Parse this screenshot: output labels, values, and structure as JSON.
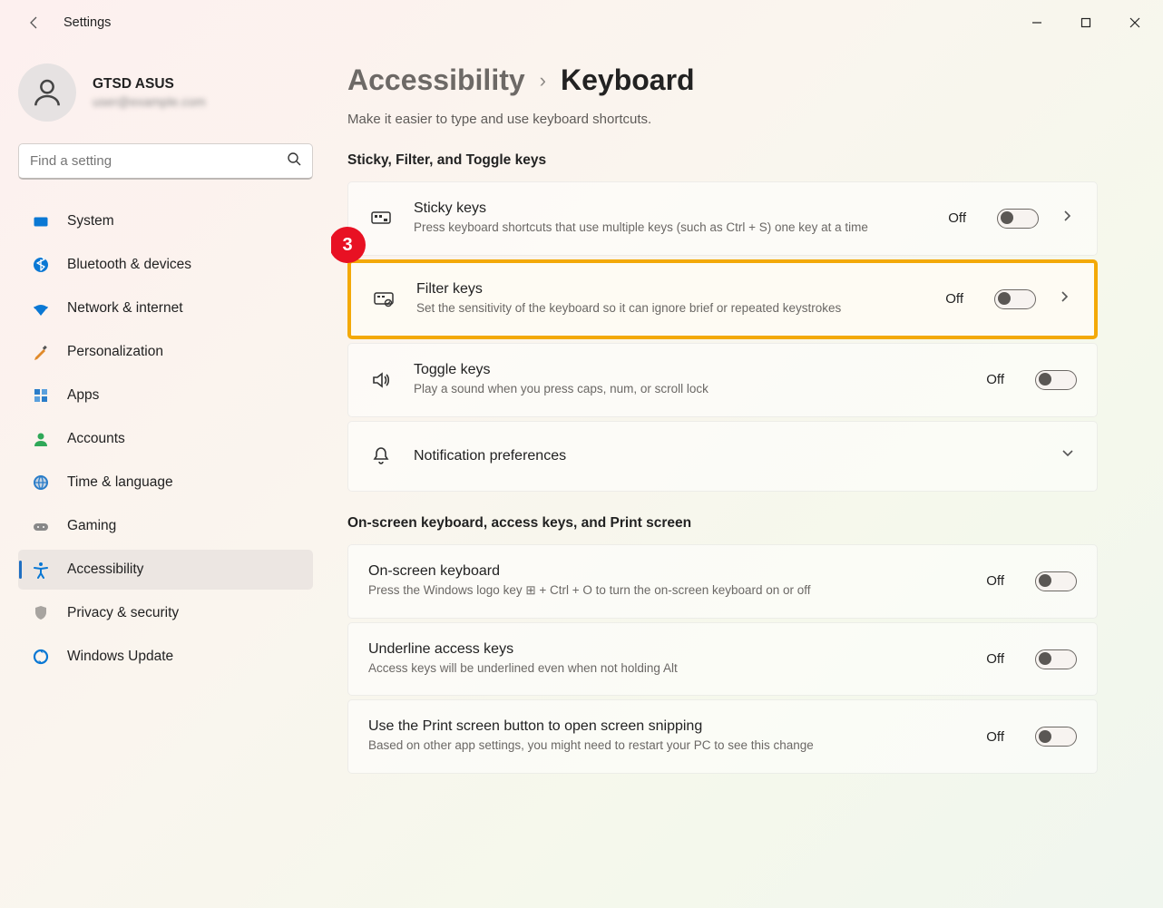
{
  "window": {
    "title": "Settings"
  },
  "profile": {
    "name": "GTSD ASUS",
    "email": "user@example.com"
  },
  "search": {
    "placeholder": "Find a setting"
  },
  "nav": {
    "items": [
      {
        "label": "System",
        "icon": "system"
      },
      {
        "label": "Bluetooth & devices",
        "icon": "bluetooth"
      },
      {
        "label": "Network & internet",
        "icon": "wifi"
      },
      {
        "label": "Personalization",
        "icon": "brush"
      },
      {
        "label": "Apps",
        "icon": "apps"
      },
      {
        "label": "Accounts",
        "icon": "person"
      },
      {
        "label": "Time & language",
        "icon": "globe"
      },
      {
        "label": "Gaming",
        "icon": "gamepad"
      },
      {
        "label": "Accessibility",
        "icon": "accessibility"
      },
      {
        "label": "Privacy & security",
        "icon": "shield"
      },
      {
        "label": "Windows Update",
        "icon": "update"
      }
    ],
    "active_index": 8
  },
  "breadcrumb": {
    "parent": "Accessibility",
    "current": "Keyboard"
  },
  "subtitle": "Make it easier to type and use keyboard shortcuts.",
  "callout_number": "3",
  "sections": [
    {
      "title": "Sticky, Filter, and Toggle keys",
      "cards": [
        {
          "title": "Sticky keys",
          "desc": "Press keyboard shortcuts that use multiple keys (such as Ctrl + S) one key at a time",
          "state": "Off",
          "icon": "sticky",
          "chevron": true
        },
        {
          "title": "Filter keys",
          "desc": "Set the sensitivity of the keyboard so it can ignore brief or repeated keystrokes",
          "state": "Off",
          "icon": "filter",
          "chevron": true,
          "highlighted": true
        },
        {
          "title": "Toggle keys",
          "desc": "Play a sound when you press caps, num, or scroll lock",
          "state": "Off",
          "icon": "sound",
          "chevron": false
        },
        {
          "title": "Notification preferences",
          "desc": "",
          "state": "",
          "icon": "bell",
          "chevron": "down",
          "notoggle": true
        }
      ]
    },
    {
      "title": "On-screen keyboard, access keys, and Print screen",
      "cards": [
        {
          "title": "On-screen keyboard",
          "desc": "Press the Windows logo key ⊞ + Ctrl + O to turn the on-screen keyboard on or off",
          "state": "Off",
          "noicon": true
        },
        {
          "title": "Underline access keys",
          "desc": "Access keys will be underlined even when not holding Alt",
          "state": "Off",
          "noicon": true
        },
        {
          "title": "Use the Print screen button to open screen snipping",
          "desc": "Based on other app settings, you might need to restart your PC to see this change",
          "state": "Off",
          "noicon": true
        }
      ]
    }
  ]
}
